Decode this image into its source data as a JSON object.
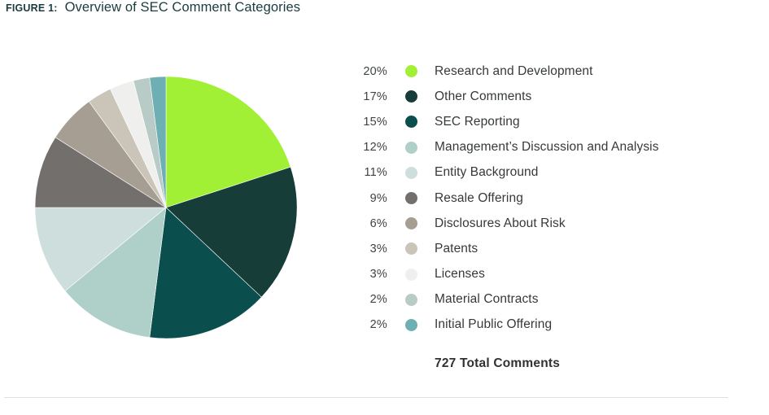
{
  "figure": {
    "label": "FIGURE 1:",
    "title": "Overview of SEC Comment Categories"
  },
  "legend": {
    "items": [
      {
        "pct": "20%",
        "label": "Research and Development",
        "color": "#a2f035"
      },
      {
        "pct": "17%",
        "label": "Other Comments",
        "color": "#173d39"
      },
      {
        "pct": "15%",
        "label": "SEC Reporting",
        "color": "#0a4f4e"
      },
      {
        "pct": "12%",
        "label": "Management’s Discussion and Analysis",
        "color": "#afcfc9"
      },
      {
        "pct": "11%",
        "label": "Entity Background",
        "color": "#cddedc"
      },
      {
        "pct": "9%",
        "label": "Resale Offering",
        "color": "#736f6d"
      },
      {
        "pct": "6%",
        "label": "Disclosures About Risk",
        "color": "#a69e93"
      },
      {
        "pct": "3%",
        "label": "Patents",
        "color": "#cbc4b8"
      },
      {
        "pct": "3%",
        "label": "Licenses",
        "color": "#efefee"
      },
      {
        "pct": "2%",
        "label": "Material Contracts",
        "color": "#b8cbc7"
      },
      {
        "pct": "2%",
        "label": "Initial Public Offering",
        "color": "#6dafb2"
      }
    ]
  },
  "footer": {
    "total": "727 Total Comments"
  },
  "colors": {
    "title": "#1b3c3f",
    "legend_text": "#36393a",
    "legend_pct": "#3f4344",
    "divider": "#e3dfdd",
    "background": "#ffffff"
  },
  "chart_data": {
    "type": "pie",
    "title": "Overview of SEC Comment Categories",
    "categories": [
      "Research and Development",
      "Other Comments",
      "SEC Reporting",
      "Management’s Discussion and Analysis",
      "Entity Background",
      "Resale Offering",
      "Disclosures About Risk",
      "Patents",
      "Licenses",
      "Material Contracts",
      "Initial Public Offering"
    ],
    "values": [
      20,
      17,
      15,
      12,
      11,
      9,
      6,
      3,
      3,
      2,
      2
    ],
    "value_labels": [
      "20%",
      "17%",
      "15%",
      "12%",
      "11%",
      "9%",
      "6%",
      "3%",
      "3%",
      "2%",
      "2%"
    ],
    "unit": "percent",
    "total_label": "727 Total Comments",
    "total": 727,
    "colors": [
      "#a2f035",
      "#173d39",
      "#0a4f4e",
      "#afcfc9",
      "#cddedc",
      "#736f6d",
      "#a69e93",
      "#cbc4b8",
      "#efefee",
      "#b8cbc7",
      "#6dafb2"
    ],
    "start_angle_deg": 0,
    "direction": "clockwise",
    "legend_position": "right",
    "data_labels_on_slices": false,
    "grid": false
  }
}
